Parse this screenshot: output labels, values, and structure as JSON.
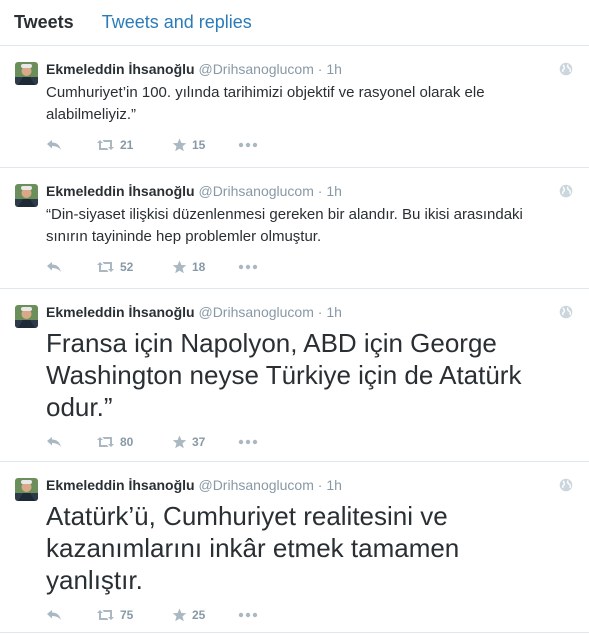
{
  "tabs": [
    {
      "label": "Tweets",
      "active": true
    },
    {
      "label": "Tweets and replies",
      "active": false
    }
  ],
  "tweets": [
    {
      "name": "Ekmeleddin İhsanoğlu",
      "handle": "@Drihsanoglucom",
      "dot": "·",
      "time": "1h",
      "text": "Cumhuriyet’in 100. yılında tarihimizi objektif ve rasyonel olarak ele alabilmeliyiz.”",
      "size": "small",
      "retweets": "21",
      "favorites": "15"
    },
    {
      "name": "Ekmeleddin İhsanoğlu",
      "handle": "@Drihsanoglucom",
      "dot": "·",
      "time": "1h",
      "text": "“Din-siyaset ilişkisi düzenlenmesi gereken bir alandır. Bu ikisi arasındaki sınırın tayininde hep problemler olmuştur.",
      "size": "small",
      "retweets": "52",
      "favorites": "18"
    },
    {
      "name": "Ekmeleddin İhsanoğlu",
      "handle": "@Drihsanoglucom",
      "dot": "·",
      "time": "1h",
      "text": "Fransa için Napolyon, ABD için George Washington neyse Türkiye için de Atatürk odur.”",
      "size": "big",
      "retweets": "80",
      "favorites": "37"
    },
    {
      "name": "Ekmeleddin İhsanoğlu",
      "handle": "@Drihsanoglucom",
      "dot": "·",
      "time": "1h",
      "text": "Atatürk’ü, Cumhuriyet realitesini ve kazanımlarını inkâr etmek tamamen yanlıştır.",
      "size": "big",
      "retweets": "75",
      "favorites": "25"
    }
  ],
  "icons": {
    "reply": "reply-icon",
    "retweet": "retweet-icon",
    "favorite": "star-icon",
    "more": "more-icon",
    "globe": "globe-icon"
  },
  "colors": {
    "link": "#2b7bb9",
    "muted": "#8899a6",
    "icon": "#aab8c2",
    "border": "#e1e8ed"
  }
}
